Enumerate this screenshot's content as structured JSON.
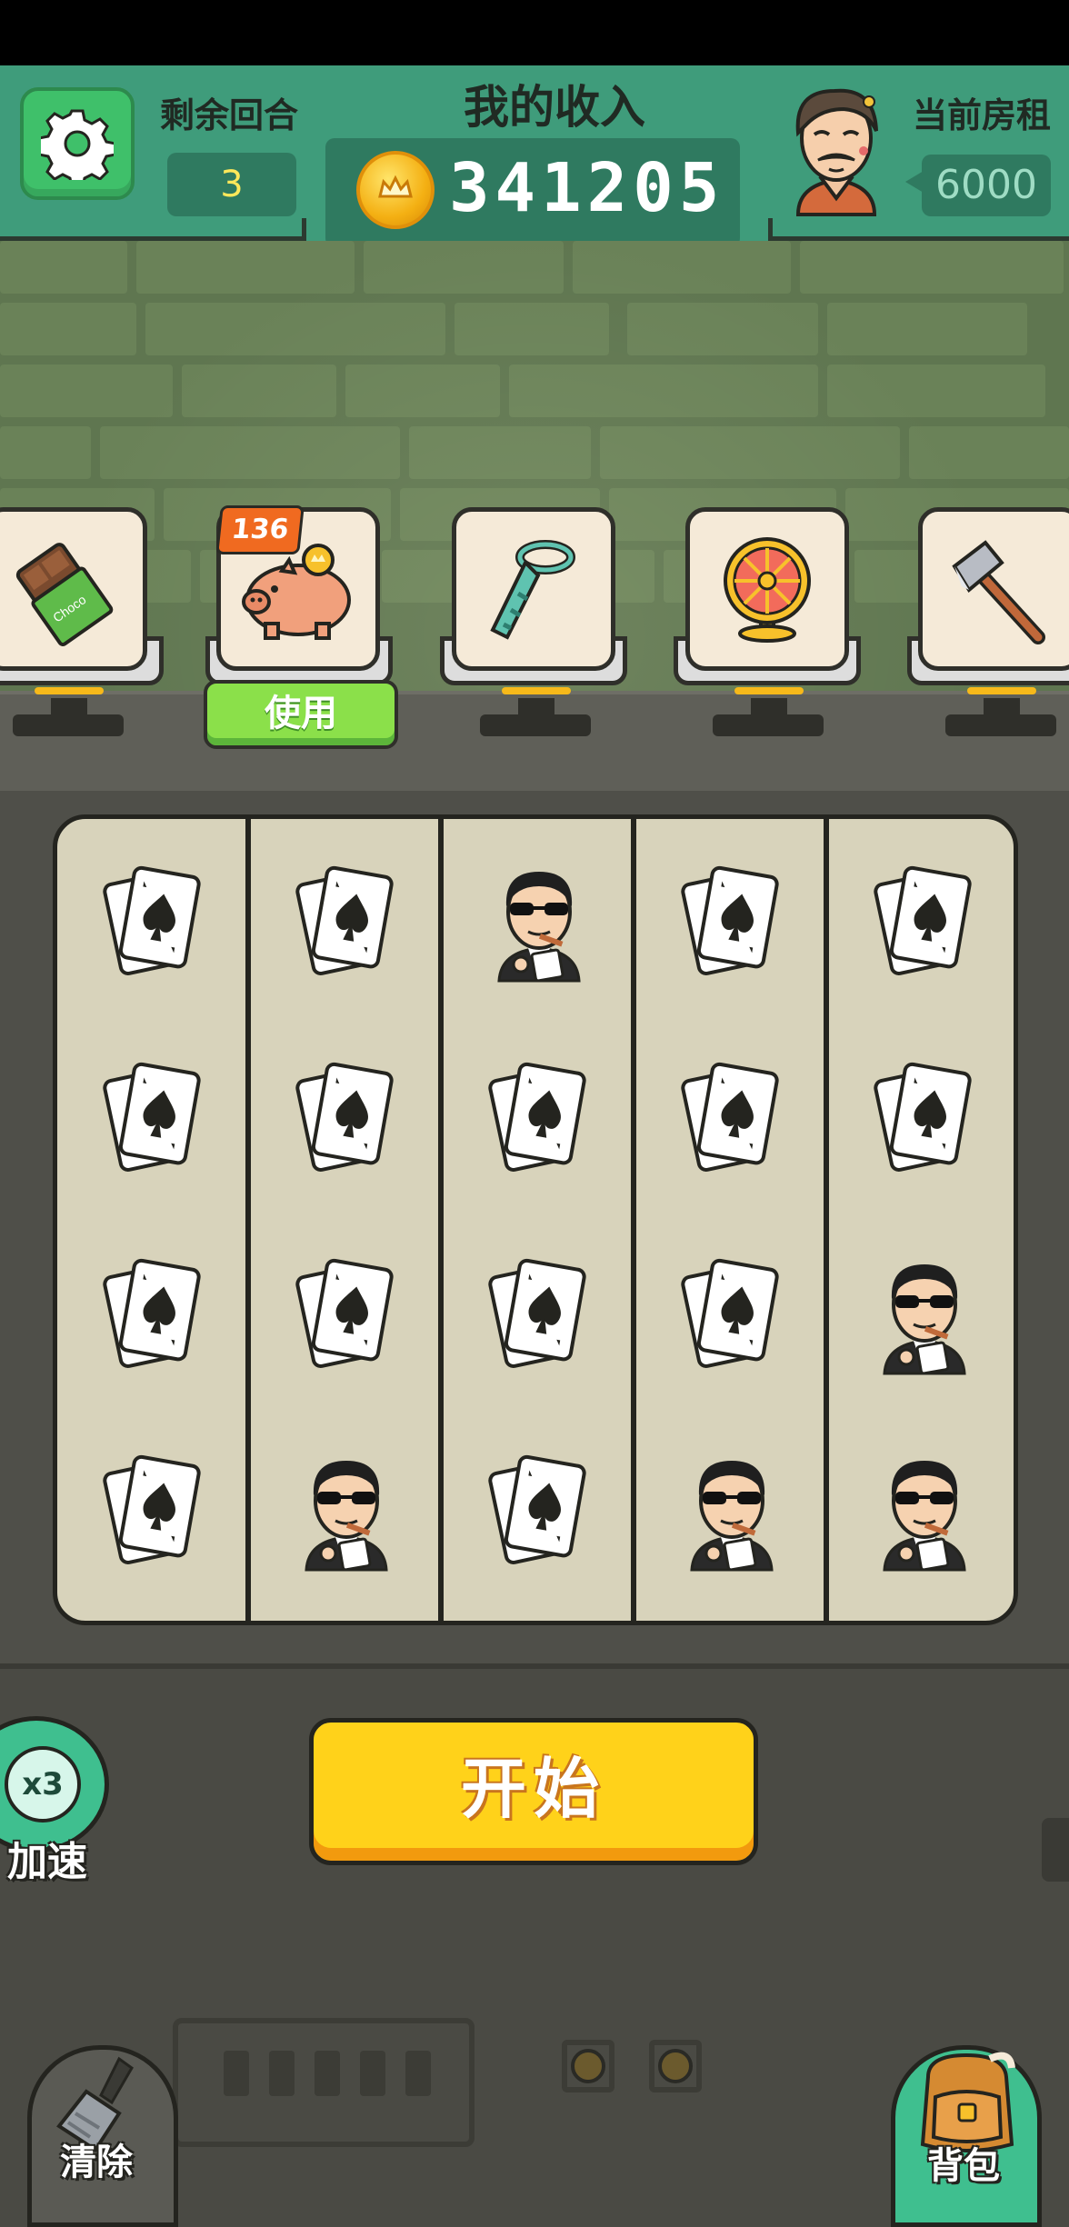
{
  "header": {
    "rounds_label": "剩余回合",
    "rounds_value": "3",
    "income_label": "我的收入",
    "income_value": "341205",
    "rent_label": "当前房租",
    "rent_value": "6000"
  },
  "items": [
    {
      "name": "chocolate-icon"
    },
    {
      "name": "piggy-bank-icon",
      "badge": "136"
    },
    {
      "name": "necktie-icon"
    },
    {
      "name": "fan-icon"
    },
    {
      "name": "axe-icon"
    }
  ],
  "use_button": "使用",
  "board": {
    "rows": [
      [
        "cards",
        "cards",
        "gambler",
        "cards",
        "cards"
      ],
      [
        "cards",
        "cards",
        "cards",
        "cards",
        "cards"
      ],
      [
        "cards",
        "cards",
        "cards",
        "cards",
        "gambler"
      ],
      [
        "cards",
        "gambler",
        "cards",
        "gambler",
        "gambler"
      ]
    ]
  },
  "speed": {
    "badge": "x3",
    "label": "加速"
  },
  "start_button": "开始",
  "clear_label": "清除",
  "bag_label": "背包",
  "colors": {
    "header": "#3f9c7b",
    "start": "#ffd21a",
    "use": "#8be04a",
    "badge": "#f06a20"
  }
}
